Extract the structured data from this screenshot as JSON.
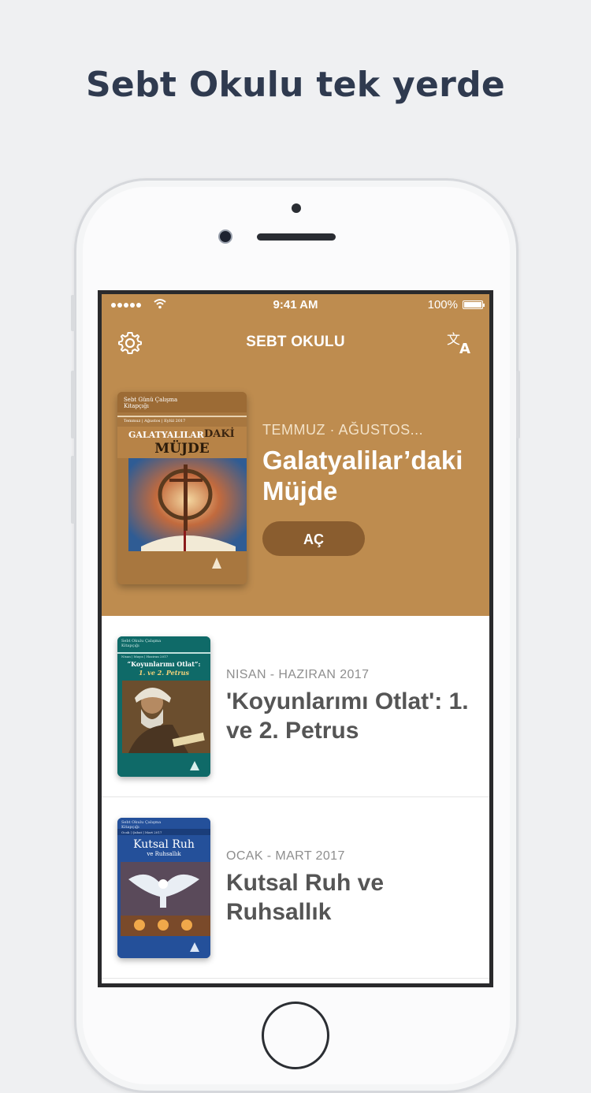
{
  "headline": "Sebt Okulu tek yerde",
  "status_bar": {
    "time": "9:41 AM",
    "battery": "100%"
  },
  "nav": {
    "title": "SEBT OKULU"
  },
  "featured": {
    "date": "TEMMUZ · AĞUSTOS...",
    "title": "Galatyalilar’daki Müjde",
    "button": "AÇ",
    "cover": {
      "top": "Sebt Günü Çalışma Kitapçığı",
      "sub": "Temmuz | Ağustos | Eylül 2017",
      "title_a": "GALATYALILAR",
      "title_b": "DAKİ",
      "title_c": "MÜJDE",
      "colors": {
        "bg": "#a8773f",
        "sky": "#3f6aa0"
      }
    }
  },
  "lessons": [
    {
      "date": "NISAN - HAZIRAN 2017",
      "title": "'Koyunlarımı Otlat': 1. ve 2. Petrus",
      "cover": {
        "top": "Sebt Okulu Çalışma Kitapçığı",
        "sub": "Nisan | Mayıs | Haziran 2017",
        "title_a": "“Koyunlarımı Otlat”:",
        "title_b": "1. ve 2. Petrus",
        "bg": "#0f6a68"
      }
    },
    {
      "date": "OCAK - MART 2017",
      "title": "Kutsal Ruh ve Ruhsallık",
      "cover": {
        "top": "Sebt Okulu Çalışma Kitapçığı",
        "sub": "Ocak | Şubat | Mart 2017",
        "title_a": "Kutsal Ruh",
        "title_b": "ve Ruhsallık",
        "bg": "#24509a"
      }
    }
  ],
  "colors": {
    "hero": "#be8c4f",
    "button": "#8a5d2f",
    "headline": "#2f3a4f"
  }
}
